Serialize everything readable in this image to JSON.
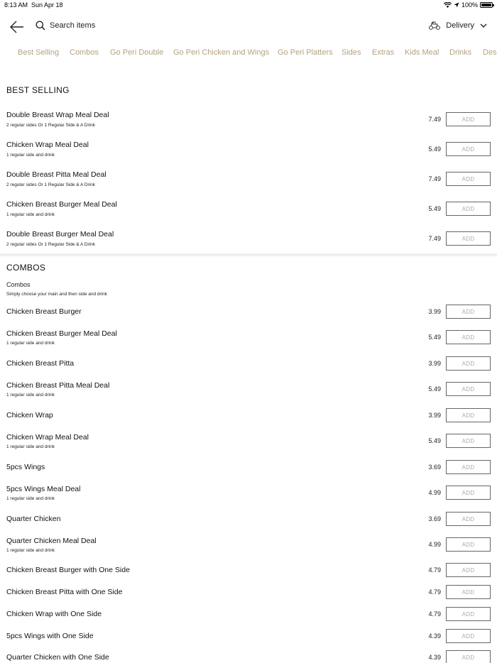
{
  "status_bar": {
    "time": "8:13 AM",
    "date": "Sun Apr 18",
    "battery": "100%"
  },
  "header": {
    "back_icon": "back-arrow-icon",
    "search_placeholder": "Search items",
    "delivery_label": "Delivery"
  },
  "tabs": [
    "Best Selling",
    "Combos",
    "Go Peri Double",
    "Go Peri Chicken and Wings",
    "Go Peri Platters",
    "Sides",
    "Extras",
    "Kids Meal",
    "Drinks",
    "Des"
  ],
  "colors": {
    "tab_text": "#b5a27f",
    "divider": "#efefef"
  },
  "best_selling": {
    "title": "BEST SELLING",
    "items": [
      {
        "name": "Double Breast Wrap Meal Deal",
        "desc": "2 regular sides Or 1 Regular Side & A Drink",
        "price": "7.49",
        "add": "ADD"
      },
      {
        "name": "Chicken Wrap Meal Deal",
        "desc": "1 regular side and drink",
        "price": "5.49",
        "add": "ADD"
      },
      {
        "name": "Double Breast Pitta Meal Deal",
        "desc": "2 regular sides Or 1 Regular Side & A Drink",
        "price": "7.49",
        "add": "ADD"
      },
      {
        "name": "Chicken Breast Burger Meal Deal",
        "desc": "1 regular side and drink",
        "price": "5.49",
        "add": "ADD"
      },
      {
        "name": "Double Breast Burger Meal Deal",
        "desc": "2 regular sides Or 1 Regular Side & A Drink",
        "price": "7.49",
        "add": "ADD"
      }
    ]
  },
  "combos": {
    "title": "COMBOS",
    "subtitle": "Combos",
    "subtitle_desc": "Simply choose your main and then side and drink",
    "items": [
      {
        "name": "Chicken Breast Burger",
        "desc": "",
        "price": "3.99",
        "add": "ADD"
      },
      {
        "name": "Chicken Breast Burger Meal Deal",
        "desc": "1 regular side and drink",
        "price": "5.49",
        "add": "ADD"
      },
      {
        "name": "Chicken Breast Pitta",
        "desc": "",
        "price": "3.99",
        "add": "ADD"
      },
      {
        "name": "Chicken Breast Pitta Meal Deal",
        "desc": "1 regular side and drink",
        "price": "5.49",
        "add": "ADD"
      },
      {
        "name": "Chicken Wrap",
        "desc": "",
        "price": "3.99",
        "add": "ADD"
      },
      {
        "name": "Chicken Wrap Meal Deal",
        "desc": "1 regular side and drink",
        "price": "5.49",
        "add": "ADD"
      },
      {
        "name": "5pcs Wings",
        "desc": "",
        "price": "3.69",
        "add": "ADD"
      },
      {
        "name": "5pcs Wings Meal Deal",
        "desc": "1 regular side and drink",
        "price": "4.99",
        "add": "ADD"
      },
      {
        "name": "Quarter Chicken",
        "desc": "",
        "price": "3.69",
        "add": "ADD"
      },
      {
        "name": "Quarter Chicken Meal Deal",
        "desc": "1 regular side and drink",
        "price": "4.99",
        "add": "ADD"
      },
      {
        "name": "Chicken Breast Burger with One Side",
        "desc": "",
        "price": "4.79",
        "add": "ADD"
      },
      {
        "name": "Chicken Breast Pitta with One Side",
        "desc": "",
        "price": "4.79",
        "add": "ADD"
      },
      {
        "name": "Chicken Wrap with One Side",
        "desc": "",
        "price": "4.79",
        "add": "ADD"
      },
      {
        "name": "5pcs Wings with One Side",
        "desc": "",
        "price": "4.39",
        "add": "ADD"
      },
      {
        "name": "Quarter Chicken with One Side",
        "desc": "",
        "price": "4.39",
        "add": "ADD"
      }
    ]
  }
}
